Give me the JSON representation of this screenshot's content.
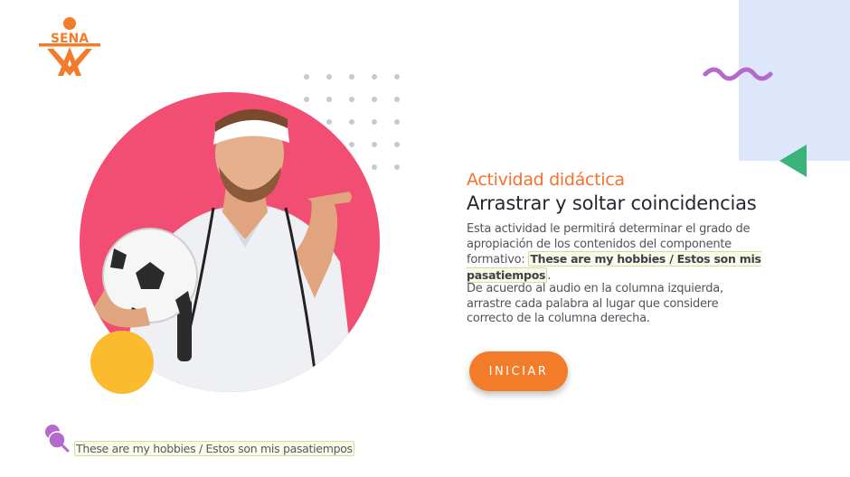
{
  "brand": {
    "logo_text": "SENA",
    "logo_color": "#f27c2a"
  },
  "activity": {
    "kicker": "Actividad didáctica",
    "title": "Arrastrar y soltar coincidencias",
    "description_intro": "Esta actividad le permitirá determinar el grado de apropiación de los contenidos del componente formativo:",
    "component_name": "These are my hobbies /  Estos son mis pasatiempos",
    "description_end": ".",
    "instructions": "De acuerdo al audio en la columna izquierda, arrastre cada palabra al lugar que considere correcto de la columna derecha."
  },
  "start_button": {
    "label": "INICIAR"
  },
  "audio_row": {
    "label": "These are my hobbies /  Estos son mis pasatiempos",
    "icon": "pushpin-icon"
  },
  "colors": {
    "accent_orange": "#f27c2a",
    "hero_pink": "#f24d72",
    "yellow": "#fbbb2e",
    "panel_blue": "#dde6fb",
    "wave_purple": "#b46acb",
    "triangle_green": "#3ab37a"
  }
}
